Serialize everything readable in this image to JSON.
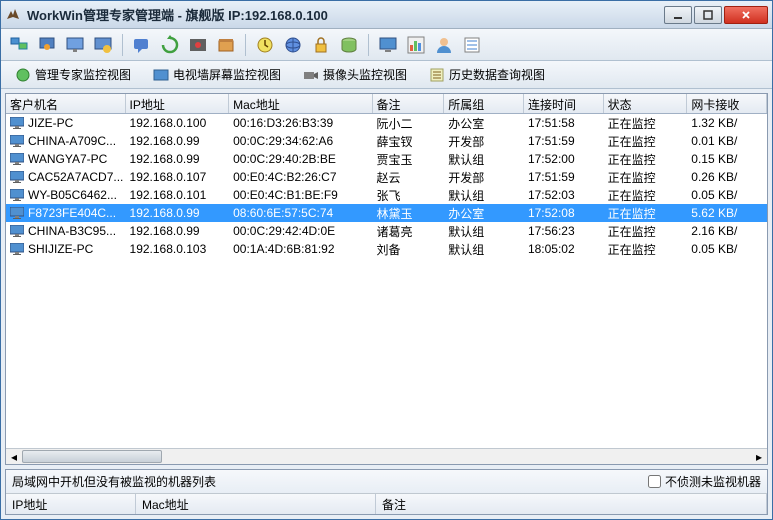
{
  "window": {
    "title": "WorkWin管理专家管理端 - 旗舰版 IP:192.168.0.100"
  },
  "viewTabs": {
    "v1": "管理专家监控视图",
    "v2": "电视墙屏幕监控视图",
    "v3": "摄像头监控视图",
    "v4": "历史数据查询视图"
  },
  "columns": {
    "c0": "客户机名",
    "c1": "IP地址",
    "c2": "Mac地址",
    "c3": "备注",
    "c4": "所属组",
    "c5": "连接时间",
    "c6": "状态",
    "c7": "网卡接收"
  },
  "rows": [
    {
      "name": "JIZE-PC",
      "ip": "192.168.0.100",
      "mac": "00:16:D3:26:B3:39",
      "remark": "阮小二",
      "group": "办公室",
      "time": "17:51:58",
      "status": "正在监控",
      "net": "1.32 KB/",
      "sel": false
    },
    {
      "name": "CHINA-A709C...",
      "ip": "192.168.0.99",
      "mac": "00:0C:29:34:62:A6",
      "remark": "薛宝钗",
      "group": "开发部",
      "time": "17:51:59",
      "status": "正在监控",
      "net": "0.01 KB/",
      "sel": false
    },
    {
      "name": "WANGYA7-PC",
      "ip": "192.168.0.99",
      "mac": "00:0C:29:40:2B:BE",
      "remark": "贾宝玉",
      "group": "默认组",
      "time": "17:52:00",
      "status": "正在监控",
      "net": "0.15 KB/",
      "sel": false
    },
    {
      "name": "CAC52A7ACD7...",
      "ip": "192.168.0.107",
      "mac": "00:E0:4C:B2:26:C7",
      "remark": "赵云",
      "group": "开发部",
      "time": "17:51:59",
      "status": "正在监控",
      "net": "0.26 KB/",
      "sel": false
    },
    {
      "name": "WY-B05C6462...",
      "ip": "192.168.0.101",
      "mac": "00:E0:4C:B1:BE:F9",
      "remark": "张飞",
      "group": "默认组",
      "time": "17:52:03",
      "status": "正在监控",
      "net": "0.05 KB/",
      "sel": false
    },
    {
      "name": "F8723FE404C...",
      "ip": "192.168.0.99",
      "mac": "08:60:6E:57:5C:74",
      "remark": "林黛玉",
      "group": "办公室",
      "time": "17:52:08",
      "status": "正在监控",
      "net": "5.62 KB/",
      "sel": true
    },
    {
      "name": "CHINA-B3C95...",
      "ip": "192.168.0.99",
      "mac": "00:0C:29:42:4D:0E",
      "remark": "诸葛亮",
      "group": "默认组",
      "time": "17:56:23",
      "status": "正在监控",
      "net": "2.16 KB/",
      "sel": false
    },
    {
      "name": "SHIJIZE-PC",
      "ip": "192.168.0.103",
      "mac": "00:1A:4D:6B:81:92",
      "remark": "刘备",
      "group": "默认组",
      "time": "18:05:02",
      "status": "正在监控",
      "net": "0.05 KB/",
      "sel": false
    }
  ],
  "bottom": {
    "label": "局域网中开机但没有被监视的机器列表",
    "checkbox": "不侦测未监视机器",
    "cols": {
      "c0": "IP地址",
      "c1": "Mac地址",
      "c2": "备注"
    }
  },
  "icons": {
    "app": "eagle-icon"
  }
}
